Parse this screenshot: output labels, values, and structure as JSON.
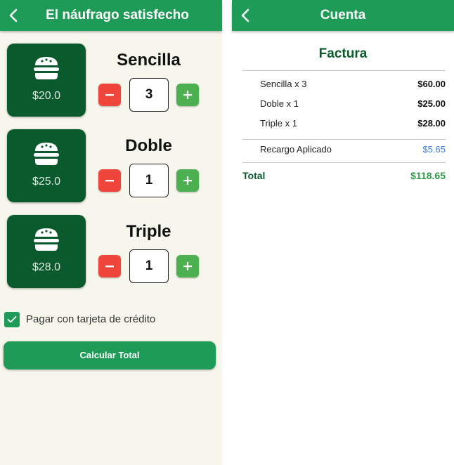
{
  "left_screen": {
    "title": "El náufrago satisfecho",
    "products": [
      {
        "name": "Sencilla",
        "price": "$20.0",
        "quantity": "3"
      },
      {
        "name": "Doble",
        "price": "$25.0",
        "quantity": "1"
      },
      {
        "name": "Triple",
        "price": "$28.0",
        "quantity": "1"
      }
    ],
    "credit_card": {
      "label": "Pagar con tarjeta de crédito",
      "checked": true
    },
    "calculate_button": "Calcular Total"
  },
  "right_screen": {
    "title": "Cuenta",
    "invoice_title": "Factura",
    "items": [
      {
        "label": "Sencilla x 3",
        "amount": "$60.00"
      },
      {
        "label": "Doble x 1",
        "amount": "$25.00"
      },
      {
        "label": "Triple x 1",
        "amount": "$28.00"
      }
    ],
    "surcharge": {
      "label": "Recargo Aplicado",
      "amount": "$5.65"
    },
    "total": {
      "label": "Total",
      "amount": "$118.65"
    }
  },
  "colors": {
    "appbar": "#1e9b57",
    "card": "#0b5a2e",
    "minus": "#f0453a",
    "plus": "#4caf50",
    "surcharge": "#3d7fd6"
  },
  "icons": {
    "back": "chevron-left-icon",
    "product": "burger-icon",
    "decrement": "minus-icon",
    "increment": "plus-icon",
    "checkbox": "check-icon"
  }
}
